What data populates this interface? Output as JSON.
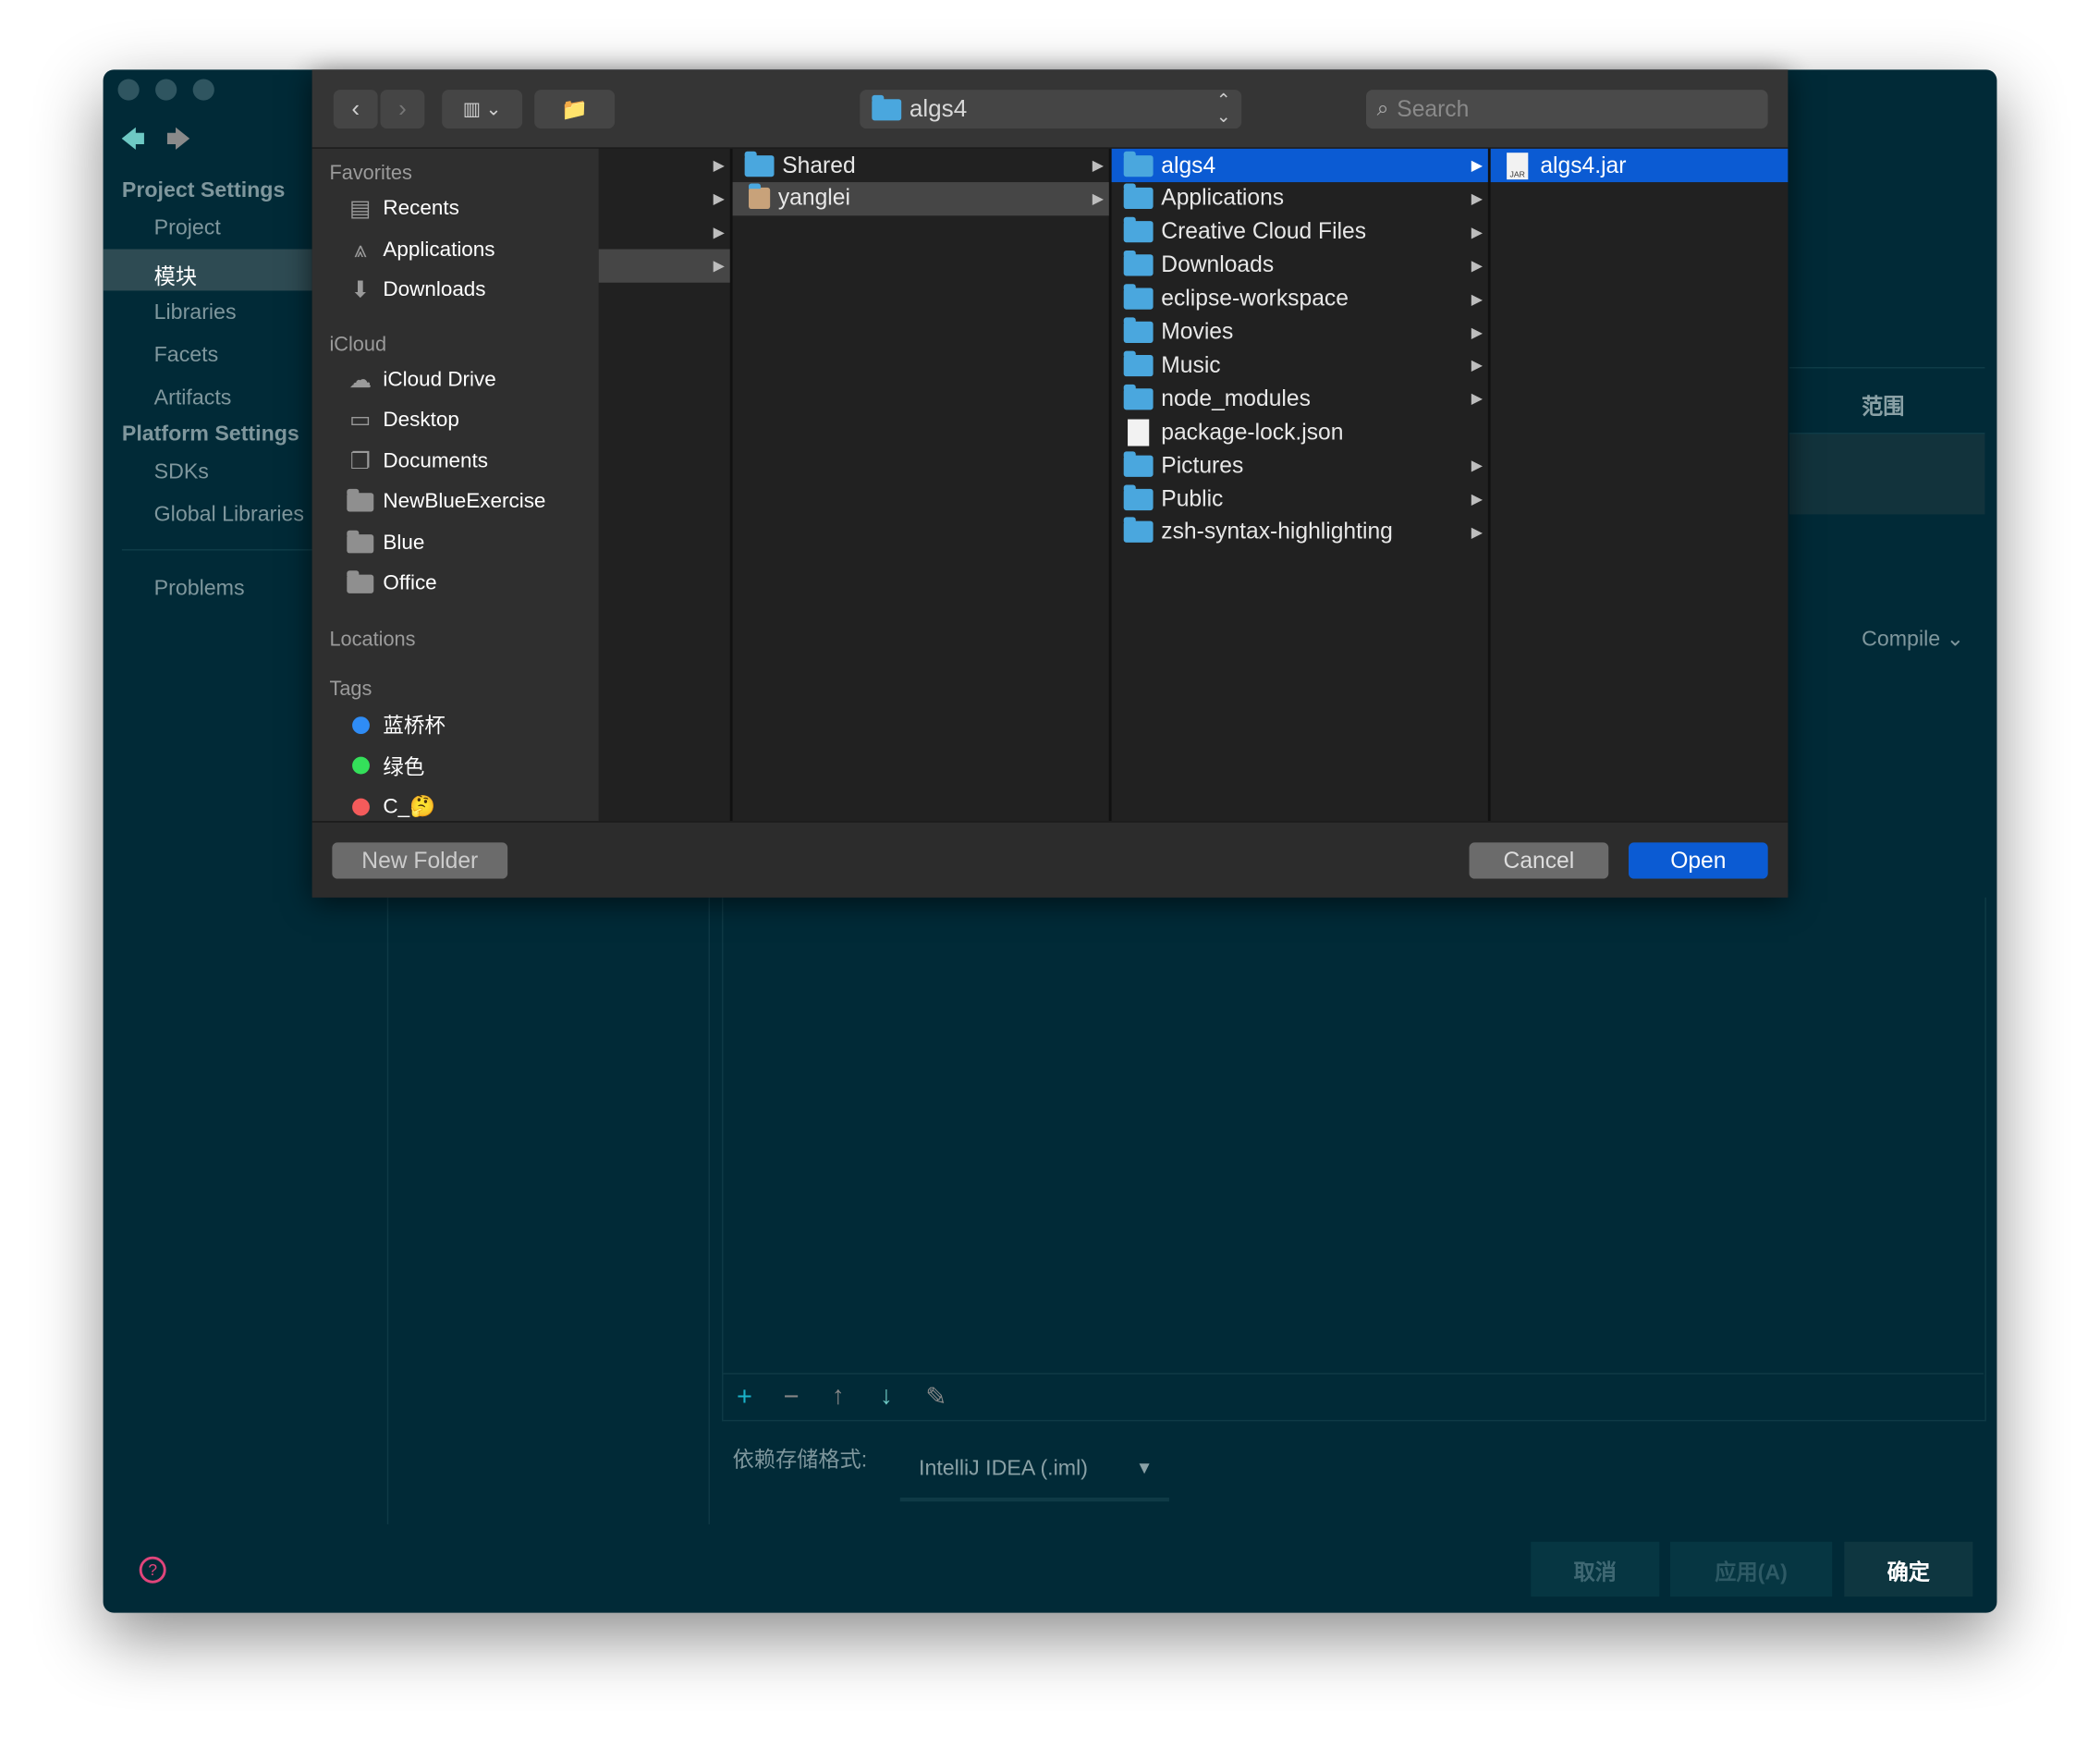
{
  "ide": {
    "nav": {
      "back_icon": "arrow-left-icon",
      "forward_icon": "arrow-right-icon"
    },
    "sidebar": {
      "project_settings": "Project Settings",
      "project_items": [
        "Project",
        "模块",
        "Libraries",
        "Facets",
        "Artifacts"
      ],
      "selected": "模块",
      "platform_settings": "Platform Settings",
      "platform_items": [
        "SDKs",
        "Global Libraries"
      ],
      "problems": "Problems"
    },
    "table": {
      "scope_header": "范围",
      "scope_value": "Compile"
    },
    "toolbar": {
      "add": "+",
      "remove": "−",
      "up": "↑",
      "down": "↓",
      "edit": "✎"
    },
    "storage": {
      "label": "依赖存储格式:",
      "value": "IntelliJ IDEA (.iml)"
    },
    "buttons": {
      "cancel": "取消",
      "apply": "应用(A)",
      "ok": "确定"
    },
    "help_icon": "question-circle-icon"
  },
  "dialog": {
    "path": "algs4",
    "search_placeholder": "Search",
    "sidebar": {
      "favorites_header": "Favorites",
      "favorites": [
        {
          "label": "Recents",
          "icon": "recents-icon"
        },
        {
          "label": "Applications",
          "icon": "applications-icon"
        },
        {
          "label": "Downloads",
          "icon": "downloads-icon"
        }
      ],
      "icloud_header": "iCloud",
      "icloud": [
        {
          "label": "iCloud Drive",
          "icon": "cloud-icon"
        },
        {
          "label": "Desktop",
          "icon": "desktop-icon"
        },
        {
          "label": "Documents",
          "icon": "documents-icon"
        },
        {
          "label": "NewBlueExercise",
          "icon": "folder-icon"
        },
        {
          "label": "Blue",
          "icon": "folder-icon"
        },
        {
          "label": "Office",
          "icon": "folder-icon"
        }
      ],
      "locations_header": "Locations",
      "tags_header": "Tags",
      "tags": [
        {
          "label": "蓝桥杯",
          "color": "#2f8cf5"
        },
        {
          "label": "绿色",
          "color": "#34e05a"
        },
        {
          "label": "C_🤔",
          "color": "#f45b5b"
        }
      ]
    },
    "columns": {
      "col2": [
        {
          "label": "Shared",
          "type": "folder",
          "arrow": true
        },
        {
          "label": "yanglei",
          "type": "home",
          "arrow": true,
          "selected": "gray"
        }
      ],
      "col3": [
        {
          "label": "algs4",
          "type": "folder",
          "arrow": true,
          "selected": "blue"
        },
        {
          "label": "Applications",
          "type": "folder",
          "arrow": true
        },
        {
          "label": "Creative Cloud Files",
          "type": "folder",
          "arrow": true
        },
        {
          "label": "Downloads",
          "type": "folder",
          "arrow": true
        },
        {
          "label": "eclipse-workspace",
          "type": "folder",
          "arrow": true
        },
        {
          "label": "Movies",
          "type": "folder",
          "arrow": true
        },
        {
          "label": "Music",
          "type": "folder",
          "arrow": true
        },
        {
          "label": "node_modules",
          "type": "folder",
          "arrow": true
        },
        {
          "label": "package-lock.json",
          "type": "file",
          "arrow": false
        },
        {
          "label": "Pictures",
          "type": "folder",
          "arrow": true
        },
        {
          "label": "Public",
          "type": "folder",
          "arrow": true
        },
        {
          "label": "zsh-syntax-highlighting",
          "type": "folder",
          "arrow": true
        }
      ],
      "col4": [
        {
          "label": "algs4.jar",
          "type": "jar",
          "arrow": false,
          "selected": "blue"
        }
      ]
    },
    "buttons": {
      "new_folder": "New Folder",
      "cancel": "Cancel",
      "open": "Open"
    },
    "accent": "#0b5bd3"
  }
}
